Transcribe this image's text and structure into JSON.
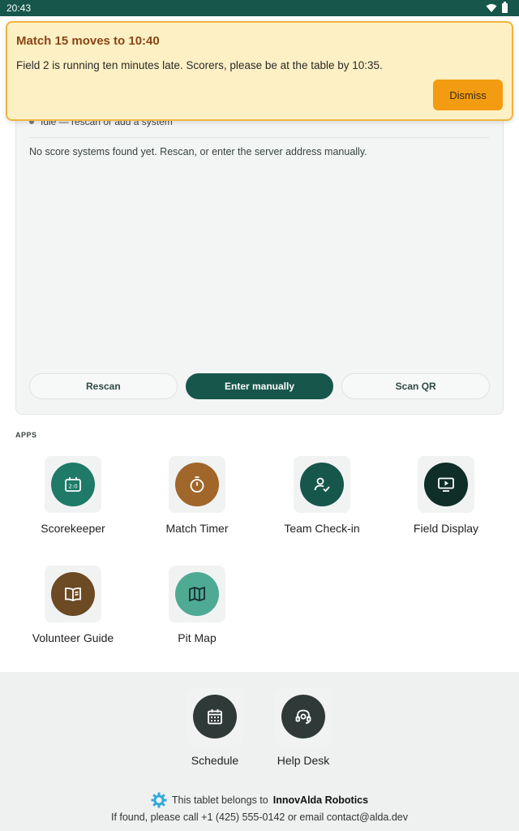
{
  "status_bar": {
    "time": "20:43",
    "wifi_icon": "wifi-icon",
    "battery_icon": "battery-icon"
  },
  "banner": {
    "title": "Match 15 moves to 10:40",
    "message": "Field 2 is running ten minutes late. Scorers, please be at the table by 10:35.",
    "dismiss_label": "Dismiss"
  },
  "discovery": {
    "status": "Idle — rescan or add a system",
    "empty_message": "No score systems found yet. Rescan, or enter the server address manually.",
    "actions": {
      "rescan": "Rescan",
      "enter_manually": "Enter manually",
      "scan_qr": "Scan QR"
    }
  },
  "apps_section_label": "APPS",
  "apps": [
    {
      "label": "Scorekeeper",
      "icon": "scoreboard-icon",
      "color": "#1f7a68"
    },
    {
      "label": "Match Timer",
      "icon": "timer-icon",
      "color": "#a0662a"
    },
    {
      "label": "Team Check-in",
      "icon": "person-check-icon",
      "color": "#17564b"
    },
    {
      "label": "Field Display",
      "icon": "display-play-icon",
      "color": "#0f2e28"
    },
    {
      "label": "Volunteer Guide",
      "icon": "book-icon",
      "color": "#6b4a24"
    },
    {
      "label": "Pit Map",
      "icon": "map-icon",
      "color": "#4faa93"
    }
  ],
  "footer": {
    "shortcuts": [
      {
        "label": "Schedule",
        "icon": "calendar-icon",
        "color": "#2f3a38"
      },
      {
        "label": "Help Desk",
        "icon": "headset-icon",
        "color": "#2f3a38"
      }
    ],
    "owner_prefix": "This tablet belongs to",
    "owner_name": "InnovAlda Robotics",
    "contact": "If found, please call +1 (425) 555-0142 or email contact@alda.dev",
    "logo_icon": "gear-logo-icon"
  }
}
